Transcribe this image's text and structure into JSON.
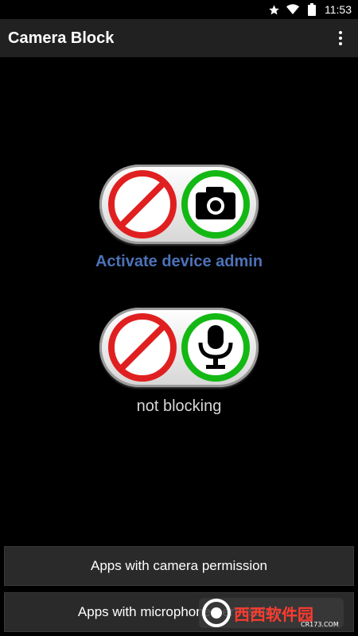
{
  "status_bar": {
    "time": "11:53",
    "icons": [
      "star-icon",
      "wifi-icon",
      "battery-icon"
    ]
  },
  "app_bar": {
    "title": "Camera Block",
    "overflow_icon": "overflow-menu-icon"
  },
  "camera_toggle": {
    "left_icon": "prohibited-icon",
    "right_icon": "camera-icon",
    "ring_colors": {
      "block": "#e02020",
      "allow": "#14b814"
    }
  },
  "admin_link": {
    "label": "Activate device admin",
    "color": "#4c72b8"
  },
  "mic_toggle": {
    "left_icon": "prohibited-icon",
    "right_icon": "microphone-icon",
    "status": "not blocking"
  },
  "buttons": {
    "camera_permission": "Apps with camera permission",
    "microphone_permission": "Apps with microphone permission"
  },
  "watermark": {
    "brand": "西西软件园",
    "site": "CR173.COM"
  }
}
